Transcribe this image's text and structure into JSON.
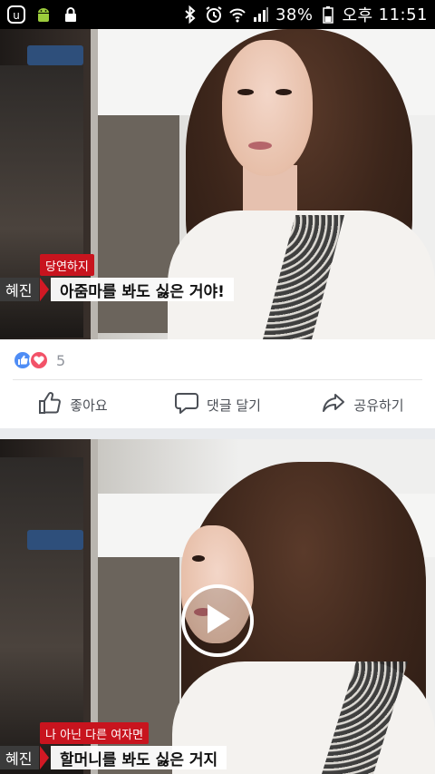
{
  "status_bar": {
    "battery": "38%",
    "ampm": "오후",
    "time": "11:51",
    "icons": [
      "app-icon",
      "android-icon",
      "lock-icon",
      "bluetooth-icon",
      "alarm-icon",
      "wifi-icon",
      "signal-icon",
      "battery-icon"
    ]
  },
  "post1": {
    "caption_tag": "당연하지",
    "speaker": "혜진",
    "subtitle": "아줌마를 봐도 싫은 거야!",
    "reaction_count": "5",
    "actions": {
      "like": "좋아요",
      "comment": "댓글 달기",
      "share": "공유하기"
    }
  },
  "post2": {
    "caption_tag": "나 아닌 다른 여자면",
    "speaker": "혜진",
    "subtitle": "할머니를 봐도 싫은 거지"
  },
  "colors": {
    "like_blue": "#4f8df5",
    "love_red": "#f25268",
    "caption_red": "#c8141e",
    "text_gray": "#4b4f56"
  }
}
